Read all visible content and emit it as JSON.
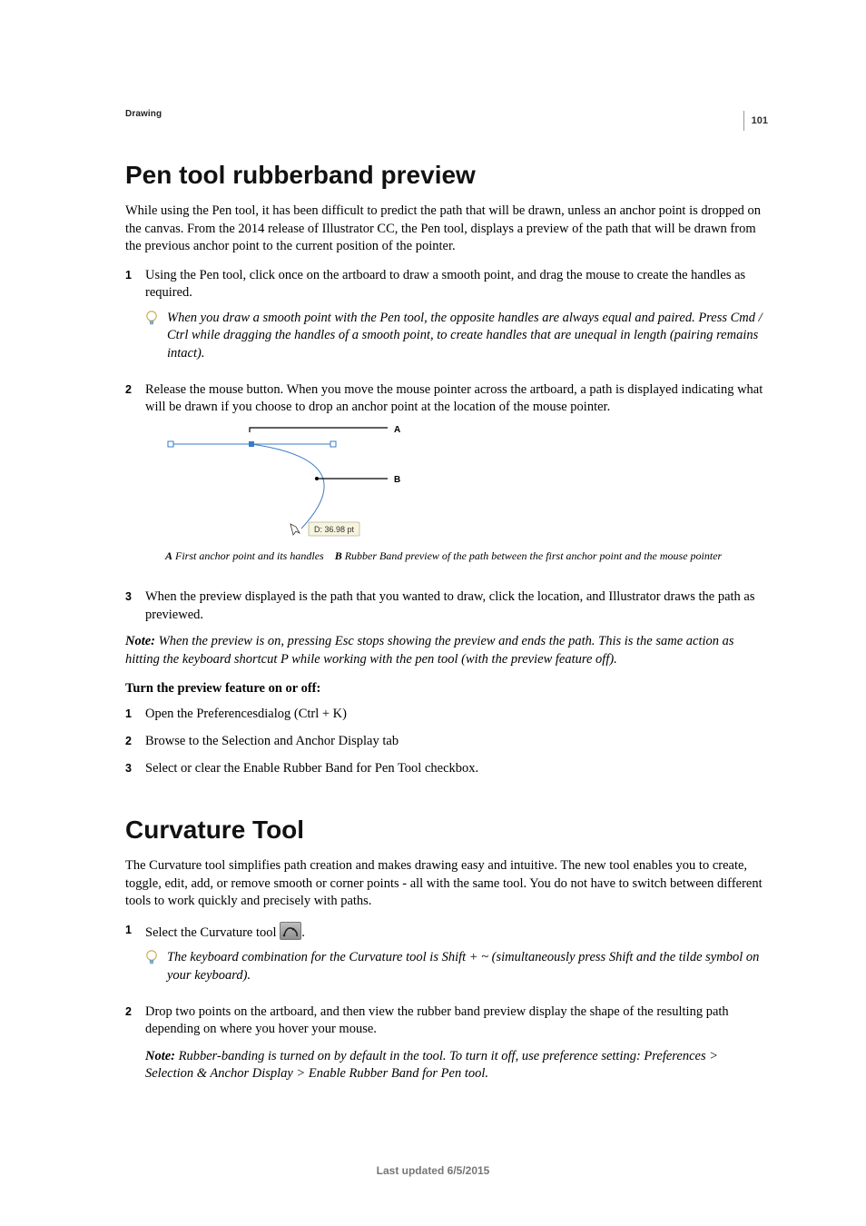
{
  "pageNumber": "101",
  "chapterHeader": "Drawing",
  "section1": {
    "title": "Pen tool rubberband preview",
    "intro": "While using the Pen tool, it has been difficult to predict the path that will be drawn, unless an anchor point is dropped on the canvas. From the 2014 release of Illustrator CC, the Pen tool, displays a preview of the path that will be drawn from the previous anchor point to the current position of the pointer.",
    "steps1": {
      "1": "Using the Pen tool, click once on the artboard to draw a smooth point, and drag the mouse to create the handles as required.",
      "tip": "When you draw a smooth point with the Pen tool, the opposite handles are always equal and paired. Press Cmd / Ctrl while dragging the handles of a smooth point, to create handles that are unequal in length (pairing remains intact).",
      "2": "Release the mouse button. When you move the mouse pointer across the artboard, a path is displayed indicating what will be drawn if you choose to drop an anchor point at the location of the mouse pointer."
    },
    "figure": {
      "labelA": "A",
      "labelB": "B",
      "tooltip": "D: 36.98 pt"
    },
    "caption": {
      "keyA": "A",
      "textA": "First anchor point and its handles",
      "keyB": "B",
      "textB": "Rubber Band preview of the path between the first anchor point and the mouse pointer"
    },
    "step3": "When the preview displayed is the path that you wanted to draw, click the location, and Illustrator draws the path as previewed.",
    "note": {
      "label": "Note:",
      "text": "When the preview is on, pressing Esc stops showing the preview and ends the path. This is the same action as hitting the keyboard shortcut P while working with the pen tool (with the preview feature off)."
    },
    "subhead": "Turn the preview feature on or off:",
    "steps2": {
      "1": "Open the Preferencesdialog (Ctrl + K)",
      "2": "Browse to the Selection and Anchor Display tab",
      "3": "Select or clear the Enable Rubber Band for Pen Tool checkbox."
    }
  },
  "section2": {
    "title": "Curvature Tool",
    "intro": "The Curvature tool simplifies path creation and makes drawing easy and intuitive. The new tool enables you to create, toggle, edit, add, or remove smooth or corner points - all with the same tool. You do not have to switch between different tools to work quickly and precisely with paths.",
    "steps": {
      "1_pre": "Select the Curvature tool ",
      "1_post": ".",
      "tip": "The keyboard combination for the Curvature tool is Shift + ~ (simultaneously press Shift and the tilde symbol on your keyboard).",
      "2": "Drop two points on the artboard, and then view the rubber band preview display the shape of the resulting path depending on where you hover your mouse.",
      "note_label": "Note:",
      "note_text": "Rubber-banding is turned on by default in the tool. To turn it off, use preference setting: Preferences > Selection & Anchor Display > Enable Rubber Band for Pen tool."
    }
  },
  "footer": "Last updated 6/5/2015"
}
